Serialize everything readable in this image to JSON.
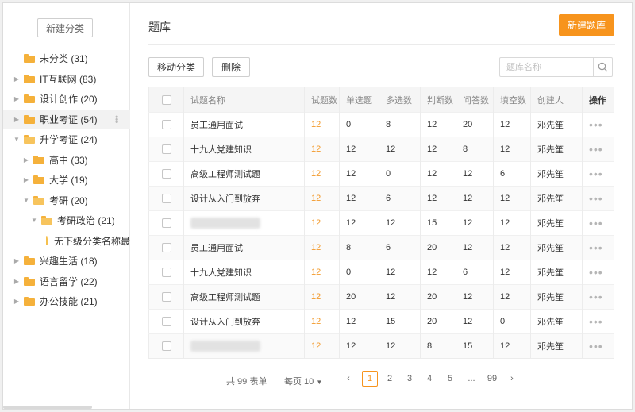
{
  "sidebar": {
    "new_category_label": "新建分类",
    "items": [
      {
        "label": "未分类 (31)"
      },
      {
        "label": "IT互联网 (83)"
      },
      {
        "label": "设计创作 (20)"
      },
      {
        "label": "职业考证 (54)"
      },
      {
        "label": "升学考证 (24)"
      },
      {
        "label": "高中 (33)"
      },
      {
        "label": "大学 (19)"
      },
      {
        "label": "考研 (20)"
      },
      {
        "label": "考研政治 (21)"
      },
      {
        "label": "无下级分类名称最"
      },
      {
        "label": "兴趣生活 (18)"
      },
      {
        "label": "语言留学 (22)"
      },
      {
        "label": "办公技能 (21)"
      }
    ]
  },
  "header": {
    "title": "题库",
    "new_bank_label": "新建题库"
  },
  "toolbar": {
    "move_label": "移动分类",
    "delete_label": "删除",
    "search_placeholder": "题库名称"
  },
  "table": {
    "columns": [
      "试题名称",
      "试题数",
      "单选题",
      "多选数",
      "判断数",
      "问答数",
      "填空数",
      "创建人",
      "操作"
    ],
    "rows": [
      {
        "name": "员工通用面试",
        "total": "12",
        "single": "0",
        "multi": "8",
        "judge": "12",
        "qa": "20",
        "fill": "12",
        "creator": "邓先笙"
      },
      {
        "name": "十九大党建知识",
        "total": "12",
        "single": "12",
        "multi": "12",
        "judge": "12",
        "qa": "8",
        "fill": "12",
        "creator": "邓先笙"
      },
      {
        "name": "高级工程师测试题",
        "total": "12",
        "single": "12",
        "multi": "0",
        "judge": "12",
        "qa": "12",
        "fill": "6",
        "creator": "邓先笙"
      },
      {
        "name": "设计从入门到放弃",
        "total": "12",
        "single": "12",
        "multi": "6",
        "judge": "12",
        "qa": "12",
        "fill": "12",
        "creator": "邓先笙"
      },
      {
        "name": "",
        "total": "12",
        "single": "12",
        "multi": "12",
        "judge": "15",
        "qa": "12",
        "fill": "12",
        "creator": "邓先笙"
      },
      {
        "name": "员工通用面试",
        "total": "12",
        "single": "8",
        "multi": "6",
        "judge": "20",
        "qa": "12",
        "fill": "12",
        "creator": "邓先笙"
      },
      {
        "name": "十九大党建知识",
        "total": "12",
        "single": "0",
        "multi": "12",
        "judge": "12",
        "qa": "6",
        "fill": "12",
        "creator": "邓先笙"
      },
      {
        "name": "高级工程师测试题",
        "total": "12",
        "single": "20",
        "multi": "12",
        "judge": "20",
        "qa": "12",
        "fill": "12",
        "creator": "邓先笙"
      },
      {
        "name": "设计从入门到放弃",
        "total": "12",
        "single": "12",
        "multi": "15",
        "judge": "20",
        "qa": "12",
        "fill": "0",
        "creator": "邓先笙"
      },
      {
        "name": "",
        "total": "12",
        "single": "12",
        "multi": "12",
        "judge": "8",
        "qa": "15",
        "fill": "12",
        "creator": "邓先笙"
      }
    ],
    "ops_glyph": "•••"
  },
  "pager": {
    "total_label": "共 99 表单",
    "per_page_label": "每页 10",
    "prev": "‹",
    "next": "›",
    "pages": [
      "1",
      "2",
      "3",
      "4",
      "5",
      "...",
      "99"
    ],
    "current_page": "1"
  },
  "colors": {
    "accent": "#f7941d",
    "folder": "#f5b13b"
  }
}
